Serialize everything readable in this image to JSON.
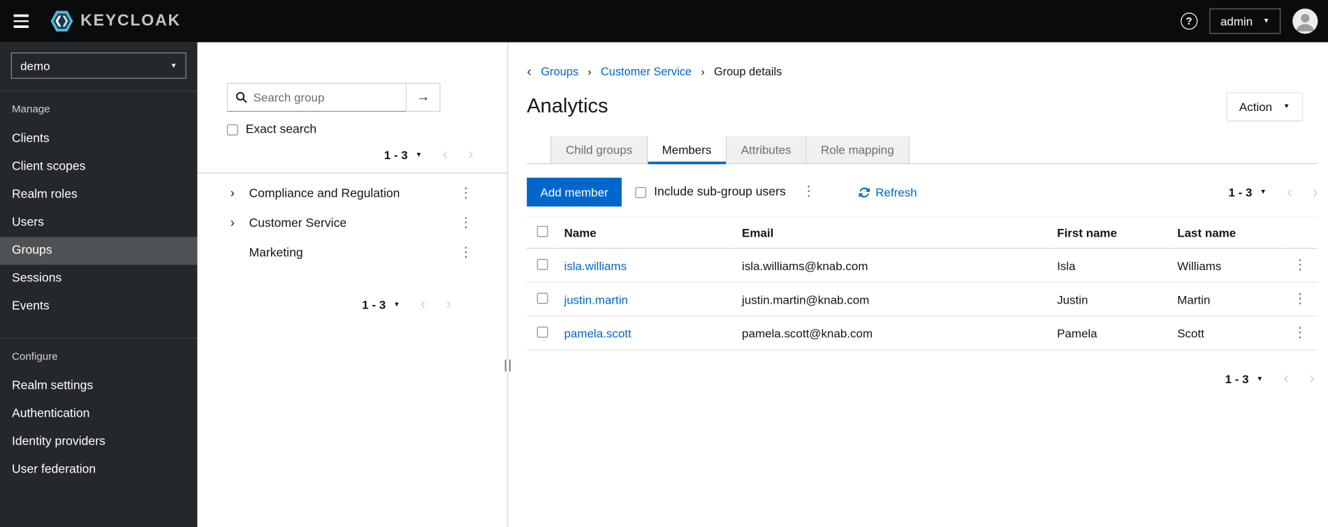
{
  "colors": {
    "accent_blue": "#0066cc",
    "link_blue": "#0066cc",
    "masthead_bg": "#0a0b0c",
    "sidebar_bg": "#24272b",
    "sidebar_selected_bg": "#4f5255",
    "tab_inactive_bg": "#f0f0f0",
    "border_gray": "#d2d2d2"
  },
  "icons": {
    "help": "?",
    "caret_down": "▼",
    "chevron_left": "‹",
    "chevron_right": "›",
    "angle_right": "›",
    "kebab": "⋮",
    "arrow_right": "→",
    "back": "‹",
    "breadcrumb_sep": "›"
  },
  "masthead": {
    "brand": "KEYCLOAK",
    "user": "admin"
  },
  "sidebar": {
    "realm": "demo",
    "selected_item": "Groups",
    "manage": {
      "label": "Manage",
      "items": [
        "Clients",
        "Client scopes",
        "Realm roles",
        "Users",
        "Groups",
        "Sessions",
        "Events"
      ]
    },
    "configure": {
      "label": "Configure",
      "items": [
        "Realm settings",
        "Authentication",
        "Identity providers",
        "User federation"
      ]
    }
  },
  "tree_panel": {
    "search_placeholder": "Search group",
    "exact_search": "Exact search",
    "pagination_top": "1 - 3",
    "pagination_bottom": "1 - 3",
    "groups": [
      {
        "name": "Compliance and Regulation",
        "expandable": true
      },
      {
        "name": "Customer Service",
        "expandable": true
      },
      {
        "name": "Marketing",
        "expandable": false
      }
    ]
  },
  "content": {
    "breadcrumb": {
      "items": [
        "Groups",
        "Customer Service",
        "Group details"
      ]
    },
    "title": "Analytics",
    "action_button": "Action",
    "tabs": [
      "Child groups",
      "Members",
      "Attributes",
      "Role mapping"
    ],
    "active_tab": "Members",
    "toolbar": {
      "add_member": "Add member",
      "include_subgroups": "Include sub-group users",
      "refresh": "Refresh",
      "pagination": "1 - 3"
    },
    "table": {
      "headers": [
        "Name",
        "Email",
        "First name",
        "Last name"
      ],
      "rows": [
        {
          "name": "isla.williams",
          "email": "isla.williams@knab.com",
          "first_name": "Isla",
          "last_name": "Williams"
        },
        {
          "name": "justin.martin",
          "email": "justin.martin@knab.com",
          "first_name": "Justin",
          "last_name": "Martin"
        },
        {
          "name": "pamela.scott",
          "email": "pamela.scott@knab.com",
          "first_name": "Pamela",
          "last_name": "Scott"
        }
      ]
    },
    "pagination_bottom": "1 - 3"
  }
}
